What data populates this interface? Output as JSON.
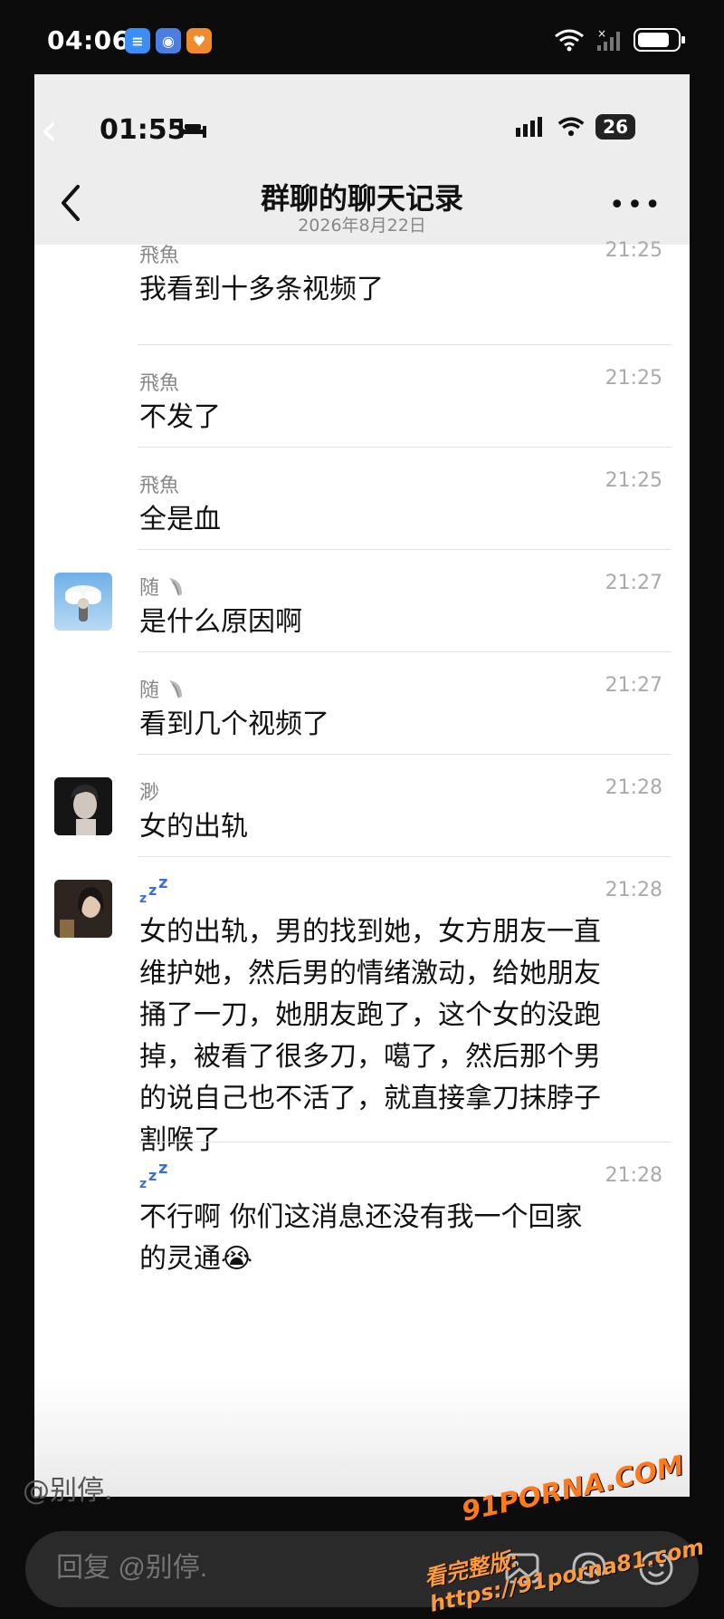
{
  "outer_status": {
    "time": "04:06",
    "icons": [
      "book-app-icon",
      "camera-app-icon",
      "heart-app-icon"
    ],
    "battery_level": 0.8
  },
  "inner_status": {
    "time": "01:55",
    "battery": "26"
  },
  "header": {
    "title": "群聊的聊天记录",
    "date": "2026年8月22日",
    "more": "•••"
  },
  "messages": [
    {
      "name": "飛魚",
      "time": "21:25",
      "text": "我看到十多条视频了",
      "avatar": "none"
    },
    {
      "name": "飛魚",
      "time": "21:25",
      "text": "不发了",
      "avatar": "none"
    },
    {
      "name": "飛魚",
      "time": "21:25",
      "text": "全是血",
      "avatar": "none"
    },
    {
      "name": "随",
      "time": "21:27",
      "text": "是什么原因啊",
      "avatar": "sky-avatar"
    },
    {
      "name": "随",
      "time": "21:27",
      "text": "看到几个视频了",
      "avatar": "none"
    },
    {
      "name": "渺",
      "time": "21:28",
      "text": "女的出轨",
      "avatar": "portrait-avatar"
    },
    {
      "name": "zzz",
      "time": "21:28",
      "text": "女的出轨，男的找到她，女方朋友一直维护她，然后男的情绪激动，给她朋友捅了一刀，她朋友跑了，这个女的没跑掉，被看了很多刀，噶了，然后那个男的说自己也不活了，就直接拿刀抹脖子割喉了",
      "avatar": "girl-avatar"
    },
    {
      "name": "zzz",
      "time": "21:28",
      "text": "不行啊 你们这消息还没有我一个回家的灵通😭",
      "avatar": "none"
    }
  ],
  "ghost_handle": "@别停.",
  "reply": {
    "placeholder": "回复 @别停."
  },
  "watermark": {
    "logo": "91PORNA.COM",
    "url": "看完整版: https://91porna81.com"
  },
  "colors": {
    "accent_orange": "#ff7a1a",
    "header_bg": "#ededed"
  }
}
